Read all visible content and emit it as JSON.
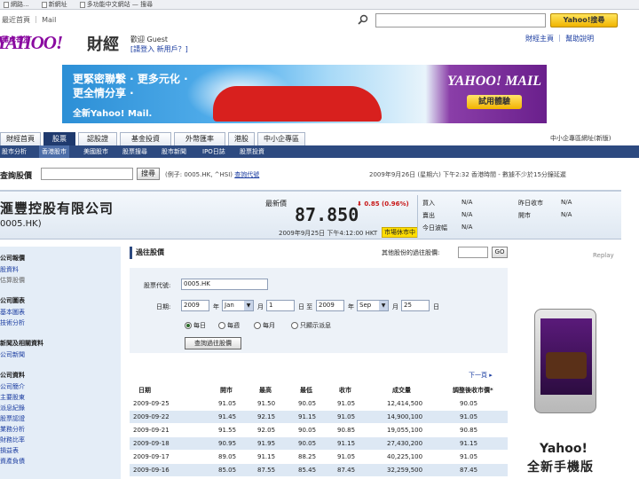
{
  "bookmarks": [
    "網路...",
    "新網址",
    "多功能中文網站 — 搜尋",
    ""
  ],
  "topnav": {
    "links": "最近首頁 ｜ Mail",
    "search_button": "Yahoo!搜尋"
  },
  "logo": {
    "main": "YAHOO!",
    "sub": "雅虎香港",
    "section": "財經"
  },
  "greeting": {
    "line1": "歡迎  Guest",
    "line2_a": "[請登入",
    "line2_b": "新用戶？]"
  },
  "topright": "財經主頁 ｜ 幫助說明",
  "banner": {
    "line1": "更緊密聯繫 · 更多元化 ·",
    "line2": "更全情分享 ·",
    "line3": "全新Yahoo! Mail.",
    "mail_logo": "YAHOO! MAIL",
    "mail_button": "試用體驗"
  },
  "tabs": [
    {
      "label": "財經首頁",
      "active": false
    },
    {
      "label": "股票",
      "active": true
    },
    {
      "label": "認股證",
      "active": false
    },
    {
      "label": "基金投資",
      "active": false
    },
    {
      "label": "外幣匯率",
      "active": false
    },
    {
      "label": "港股",
      "active": false
    },
    {
      "label": "中小企專區",
      "active": false
    }
  ],
  "tabs_right": "中小企專區網址(新版)",
  "subnav": [
    {
      "label": "股市分析",
      "active": false
    },
    {
      "label": "香港股市",
      "active": true
    },
    {
      "label": "美國股市",
      "active": false
    },
    {
      "label": "股票搜尋",
      "active": false
    },
    {
      "label": "股市新聞",
      "active": false
    },
    {
      "label": "IPO日誌",
      "active": false
    },
    {
      "label": "股票投資",
      "active": false
    }
  ],
  "quote_search": {
    "label": "查詢股價",
    "button": "搜尋",
    "example": "(例子: 0005.HK, ^HSI)",
    "example_link": "查詢代號",
    "timestamp": "2009年9月26日 (星期六) 下午2:32 香港時間 - 數據不少於15分鐘延遲"
  },
  "quote": {
    "name": "滙豐控股有限公司",
    "code": "0005.HK)",
    "last_label": "最新價",
    "price": "87.850",
    "change": "0.85 (0.96%)",
    "datetime": "2009年9月25日 下午4:12:00 HKT",
    "market_badge": "市場休市中",
    "stats_left": [
      {
        "label": "買入",
        "value": "N/A"
      },
      {
        "label": "賣出",
        "value": "N/A"
      },
      {
        "label": "今日波幅",
        "value": "N/A"
      }
    ],
    "stats_right": [
      {
        "label": "昨日收市",
        "value": "N/A"
      },
      {
        "label": "開市",
        "value": "N/A"
      }
    ]
  },
  "sidebar": [
    {
      "text": "公司報價",
      "type": "head"
    },
    {
      "text": "股資料",
      "type": "item"
    },
    {
      "text": "估算股價",
      "type": "item"
    },
    {
      "text": "公司圖表",
      "type": "head"
    },
    {
      "text": "基本圖表",
      "type": "item"
    },
    {
      "text": "技術分析",
      "type": "item"
    },
    {
      "text": "新聞及相關資料",
      "type": "head"
    },
    {
      "text": "公司新聞",
      "type": "item"
    },
    {
      "text": "公司資料",
      "type": "head"
    },
    {
      "text": "公司簡介",
      "type": "item"
    },
    {
      "text": "主要股東",
      "type": "item"
    },
    {
      "text": "派息紀錄",
      "type": "item"
    },
    {
      "text": "股票認證",
      "type": "item"
    },
    {
      "text": "業務分析",
      "type": "item"
    },
    {
      "text": "財務比率",
      "type": "item"
    },
    {
      "text": "損益表",
      "type": "item"
    },
    {
      "text": "資產負債",
      "type": "item"
    }
  ],
  "content": {
    "title": "過往股價",
    "other_label": "其他股份的過往股價:",
    "other_go": "GO",
    "form": {
      "code_label": "股票代號:",
      "code_value": "0005.HK",
      "date_label": "日期:",
      "from_year": "2009",
      "year_unit": "年",
      "from_month": "Jan",
      "month_unit": "月",
      "from_day": "1",
      "day_unit": "日 至",
      "to_year": "2009",
      "to_month": "Sep",
      "to_day": "25",
      "end_unit": "日",
      "radios": [
        {
          "label": "每日",
          "checked": true
        },
        {
          "label": "每週",
          "checked": false
        },
        {
          "label": "每月",
          "checked": false
        },
        {
          "label": "只顯示派息",
          "checked": false
        }
      ],
      "query_button": "查詢過往股價"
    },
    "next_page": "下一頁 ▸",
    "table_headers": [
      "日期",
      "開市",
      "最高",
      "最低",
      "收市",
      "成交量",
      "調整後收市價*"
    ],
    "rows": [
      [
        "2009-09-25",
        "91.05",
        "91.50",
        "90.05",
        "91.05",
        "12,414,500",
        "90.05"
      ],
      [
        "2009-09-22",
        "91.45",
        "92.15",
        "91.15",
        "91.05",
        "14,900,100",
        "91.05"
      ],
      [
        "2009-09-21",
        "91.55",
        "92.05",
        "90.05",
        "90.85",
        "19,055,100",
        "90.85"
      ],
      [
        "2009-09-18",
        "90.95",
        "91.95",
        "90.05",
        "91.15",
        "27,430,200",
        "91.15"
      ],
      [
        "2009-09-17",
        "89.05",
        "91.15",
        "88.25",
        "91.05",
        "40,225,100",
        "91.05"
      ],
      [
        "2009-09-16",
        "85.05",
        "87.55",
        "85.45",
        "87.45",
        "32,259,500",
        "87.45"
      ]
    ]
  },
  "ad": {
    "replay": "Replay",
    "line1": "Yahoo!",
    "line2": "全新手機版"
  },
  "colors": {
    "brand_purple": "#8a0aa0",
    "nav_blue": "#2d4a80",
    "down_red": "#c81818"
  }
}
